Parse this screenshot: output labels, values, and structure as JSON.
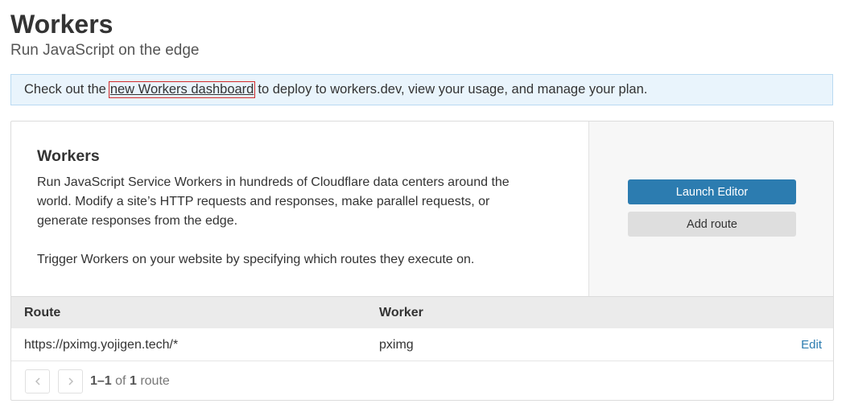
{
  "header": {
    "title": "Workers",
    "subtitle": "Run JavaScript on the edge"
  },
  "banner": {
    "prefix": "Check out the",
    "link_label": "new Workers dashboard",
    "suffix": "to deploy to workers.dev, view your usage, and manage your plan."
  },
  "info": {
    "title": "Workers",
    "description_lines": [
      "Run JavaScript Service Workers in hundreds of Cloudflare data centers around the",
      "world. Modify a site’s HTTP requests and responses, make parallel requests, or",
      "generate responses from the edge."
    ],
    "description2": "Trigger Workers on your website by specifying which routes they execute on."
  },
  "actions": {
    "launch_label": "Launch Editor",
    "add_route_label": "Add route"
  },
  "table": {
    "columns": [
      "Route",
      "Worker"
    ],
    "rows": [
      {
        "route": "https://pximg.yojigen.tech/*",
        "worker": "pximg",
        "action": "Edit"
      }
    ]
  },
  "pagination": {
    "prev_icon": "chevron-left-icon",
    "next_icon": "chevron-right-icon",
    "range": "1–1",
    "of": "of",
    "total": "1",
    "unit": "route"
  },
  "colors": {
    "accent": "#2c7cb0",
    "banner_bg": "#e9f4fc",
    "link_highlight_border": "#d12b2b"
  }
}
